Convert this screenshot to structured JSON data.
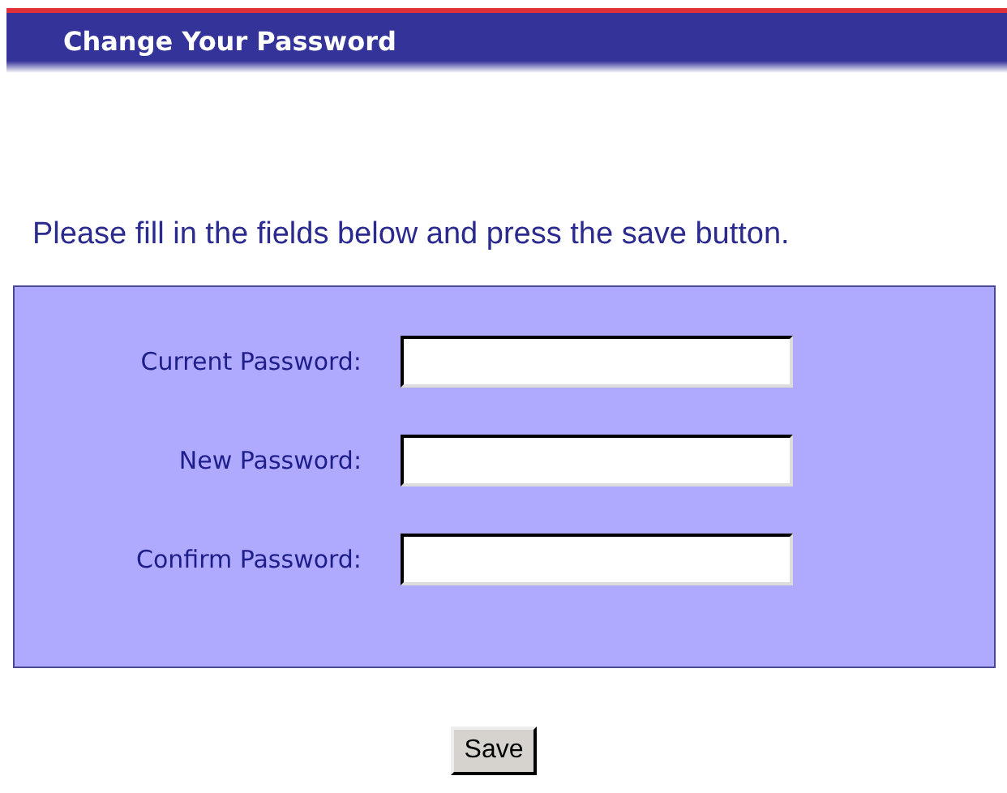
{
  "header": {
    "title": "Change Your Password"
  },
  "instruction": "Please fill in the fields below and press the save button.",
  "fields": [
    {
      "label": "Current Password:"
    },
    {
      "label": "New Password:"
    },
    {
      "label": "Confirm Password:"
    }
  ],
  "buttons": [
    "Save"
  ]
}
